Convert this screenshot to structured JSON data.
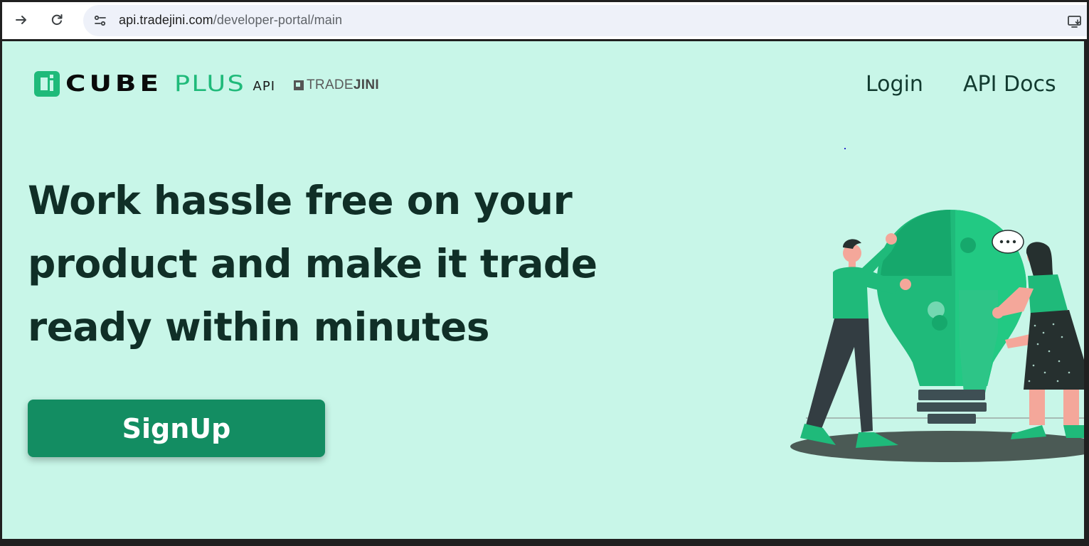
{
  "browser": {
    "url_host": "api.tradejini.com",
    "url_path": "/developer-portal/main",
    "back_icon": "arrow-right-icon",
    "reload_icon": "reload-icon",
    "site_info_icon": "tune-icon",
    "install_icon": "install-app-icon"
  },
  "header": {
    "logo": {
      "cube": "CUBE",
      "plus": "PLUS",
      "api": "API",
      "partner_light": "TRADE",
      "partner_bold": "JINI"
    },
    "nav": {
      "login": "Login",
      "api_docs": "API Docs"
    }
  },
  "hero": {
    "line1": "Work hassle free on your",
    "line2": "product and make it trade",
    "line3": "ready within minutes",
    "signup_label": "SignUp"
  },
  "colors": {
    "page_bg": "#c8f6e8",
    "brand_green": "#1fba7a",
    "button_green": "#138d62",
    "heading": "#102f27"
  }
}
